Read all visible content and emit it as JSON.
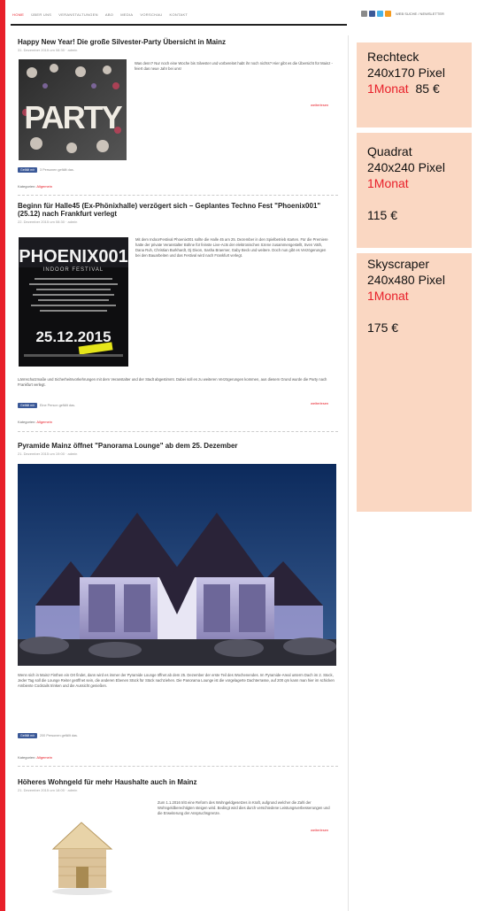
{
  "nav": [
    "HOME",
    "ÜBER UNS",
    "VERANSTALTUNGEN",
    "ABO",
    "MEDIA",
    "VORSCHAU",
    "KONTAKT"
  ],
  "topright_text": "WEB SUCHE / NEWSLETTER",
  "posts": [
    {
      "title": "Happy New Year! Die große Silvester-Party Übersicht in Mainz",
      "meta": "31. Dezember 2015 um 08:30 · admin",
      "text": "Was denn? Nur noch eine Woche bis Silvester und vorbereitet habt ihr noch nichts? Hier gibt es die Übersicht für Mainz - feiert das neue Jahr bei uns!",
      "more": "weiterlesen",
      "likes": "3 Personen gefällt das.",
      "category_label": "Kategorien:",
      "category": "Allgemein"
    },
    {
      "title": "Beginn für Halle45 (Ex-Phönixhalle) verzögert sich – Geplantes Techno Fest \"Phoenix001\" (25.12) nach Frankfurt verlegt",
      "meta": "22. Dezember 2015 um 08:30 · admin",
      "text": "Mit dem IndoorFestival Phoenix001 sollte die Halle 45 am 25. Dezember in den Spielbetrieb starten. Für die Premiere hatte der private Veranstalter Bühne für feinste Live-Acts der elektronischen Szene zusammengestellt, Sven Väth, Dana Ruh, Christian Burkhardt, Dj Dixon, Sasha Braemer, Gaby Beck und weitere. Doch nun gibt es Verzögerungen bei den Bauarbeiten und das Festival wird nach Frankfurt verlegt.",
      "text2": "Lärmschutzmaße und Sicherheitsvorkehrungen mit dem Veranstalter und der Stadt abgestimmt. Dabei soll es zu weiteren Verzögerungen kommen, aus diesem Grund wurde die Party nach Frankfurt verlegt.",
      "more": "weiterlesen",
      "likes": "Eine Person gefällt das.",
      "category_label": "Kategorien:",
      "category": "Allgemein",
      "flyer_title": "PHOENIX001",
      "flyer_sub": "INDOOR FESTIVAL",
      "flyer_date": "25.12.2015"
    },
    {
      "title": "Pyramide Mainz öffnet \"Panorama Lounge\" ab dem 25. Dezember",
      "meta": "21. Dezember 2015 um 19:00 · admin",
      "text": "Wenn sich in Mainz Finthen ein Ort findet, dann wird es immer der Pyramide Lounge öffnet ab dem 25. Dezember der erste Teil des Wochenendes. Im Pyramide-Areal unterm Dach im 2. Stock, Jeder Tag soll die Lounge Reiter geöffnet sein, die anderen Ebenen Stück für Stück nachziehen. Die Panorama Lounge ist die vorgelagerte Dachterrasse, auf 200 qm kann man hier im schicken Ambiente Cocktails trinken und die Aussicht genießen.",
      "likes": "200 Personen gefällt das.",
      "category_label": "Kategorien:",
      "category": "Allgemein"
    },
    {
      "title": "Höheres Wohngeld für mehr Haushalte auch in Mainz",
      "meta": "21. Dezember 2015 um 18:00 · admin",
      "text": "Zum 1.1.2016 tritt eine Reform des Wohngeldgesetzes in Kraft, aufgrund welcher die Zahl der Wohngeldberechtigten steigen wird. Bedingt wird dies durch verschiedene Leistungsverbesserungen und die Erweiterung der Anspruchsgrenze.",
      "more": "weiterlesen"
    }
  ],
  "fb_label": "Gefällt mir",
  "ads": [
    {
      "name": "Rechteck",
      "size": "240x170 Pixel",
      "duration": "1Monat",
      "price": "85 €"
    },
    {
      "name": "Quadrat",
      "size": "240x240 Pixel",
      "duration": "1Monat",
      "price": "115 €"
    },
    {
      "name": "Skyscraper",
      "size": "240x480 Pixel",
      "duration": "1Monat",
      "price": "175 €"
    }
  ],
  "colors": {
    "accent": "#e8202a",
    "sidebar": "#fad7c2",
    "facebook": "#3b5998"
  }
}
